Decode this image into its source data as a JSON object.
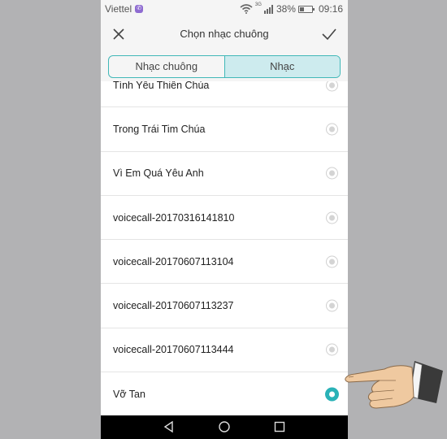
{
  "status_bar": {
    "carrier": "Viettel",
    "network": "3G",
    "battery": "38%",
    "battery_level": 0.38,
    "time": "09:16"
  },
  "header": {
    "title": "Chọn nhạc chuông",
    "close_icon": "close-icon",
    "confirm_icon": "checkmark-icon"
  },
  "tabs": [
    {
      "label": "Nhạc chuông",
      "active": false
    },
    {
      "label": "Nhạc",
      "active": true
    }
  ],
  "songs": [
    {
      "label": "Tình Yêu Thiên Chúa",
      "selected": false
    },
    {
      "label": "Trong Trái Tim Chúa",
      "selected": false
    },
    {
      "label": "Vì Em Quá Yêu Anh",
      "selected": false
    },
    {
      "label": "voicecall-20170316141810",
      "selected": false
    },
    {
      "label": "voicecall-20170607113104",
      "selected": false
    },
    {
      "label": "voicecall-20170607113237",
      "selected": false
    },
    {
      "label": "voicecall-20170607113444",
      "selected": false
    },
    {
      "label": "Vỡ Tan",
      "selected": true
    }
  ],
  "nav_bar": {
    "back_icon": "back-icon",
    "home_icon": "home-icon",
    "recents_icon": "recents-icon"
  },
  "colors": {
    "accent": "#2ab2b7",
    "tab_active_bg": "#cdebee",
    "tab_border": "#41b8b8"
  }
}
